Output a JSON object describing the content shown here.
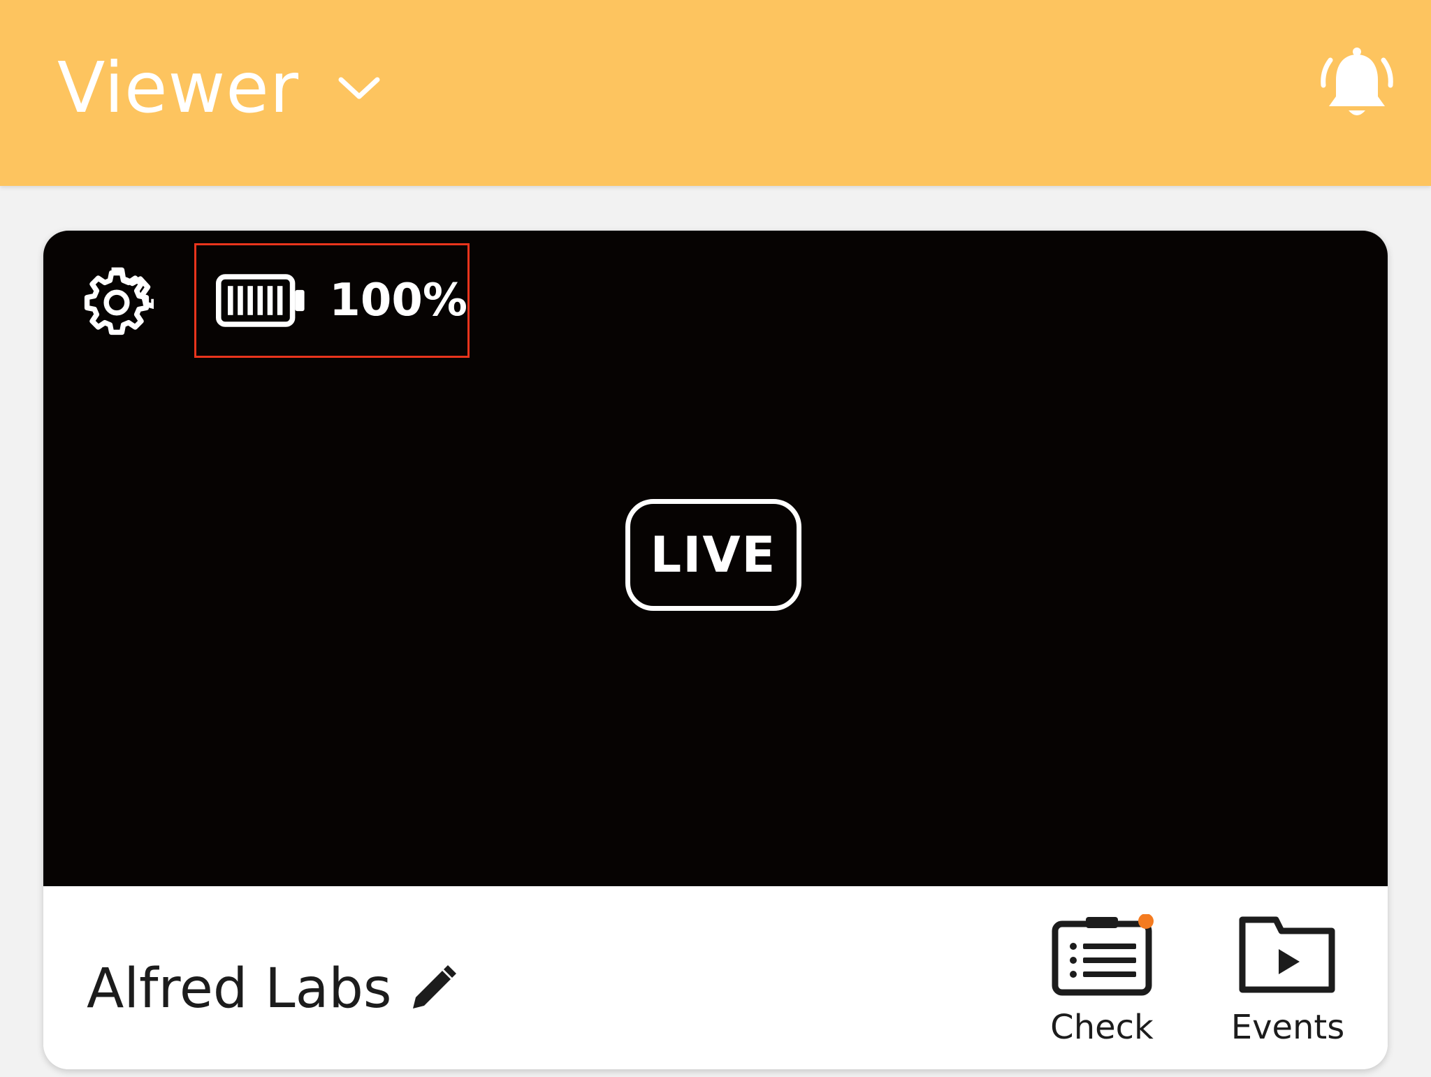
{
  "header": {
    "title": "Viewer",
    "chevron_icon": "chevron-down-icon",
    "bell_icon": "bell-ringing-icon",
    "background_color": "#fdc45f"
  },
  "camera_card": {
    "settings_icon": "gear-icon",
    "battery": {
      "icon": "battery-full-icon",
      "level_percent": 100,
      "label": "100%"
    },
    "live_badge": "LIVE",
    "camera_name": "Alfred Labs",
    "edit_icon": "pencil-icon",
    "actions": {
      "check": {
        "label": "Check",
        "icon": "checklist-icon",
        "has_notification_dot": true,
        "dot_color": "#f47b20"
      },
      "events": {
        "label": "Events",
        "icon": "video-folder-icon"
      }
    },
    "highlight_color": "#e8341c"
  }
}
